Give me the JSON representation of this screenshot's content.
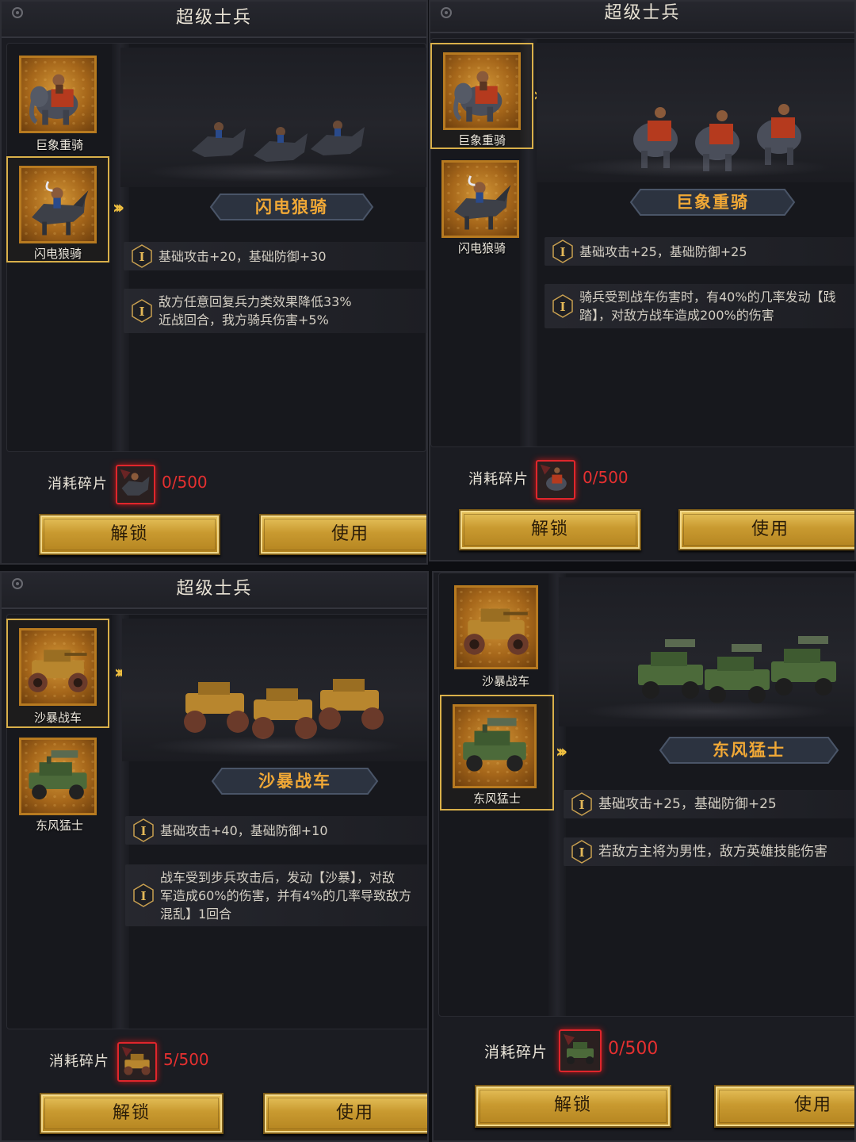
{
  "colors": {
    "accent_gold": "#d9b04a",
    "name_orange": "#f0a836",
    "cost_red": "#e53030",
    "button_gold": "#c99a30"
  },
  "panels": [
    {
      "title": "超级士兵",
      "cards": [
        {
          "label": "巨象重骑",
          "icon": "elephant-cavalry-icon"
        },
        {
          "label": "闪电狼骑",
          "icon": "wolf-cavalry-icon"
        }
      ],
      "selected_index": 1,
      "unit_name": "闪电狼骑",
      "abilities": [
        {
          "lines": [
            "基础攻击+20，基础防御+30"
          ]
        },
        {
          "lines": [
            "敌方任意回复兵力类效果降低33%",
            "近战回合，我方骑兵伤害+5%"
          ]
        }
      ],
      "cost_label": "消耗碎片",
      "cost_value": "0/500",
      "unlock_label": "解锁",
      "use_label": "使用"
    },
    {
      "title": "超级士兵",
      "cards": [
        {
          "label": "巨象重骑",
          "icon": "elephant-cavalry-icon"
        },
        {
          "label": "闪电狼骑",
          "icon": "wolf-cavalry-icon"
        }
      ],
      "selected_index": 0,
      "unit_name": "巨象重骑",
      "abilities": [
        {
          "lines": [
            "基础攻击+25，基础防御+25"
          ]
        },
        {
          "lines": [
            "骑兵受到战车伤害时，有40%的几率发动【践",
            "踏】，对敌方战车造成200%的伤害"
          ]
        }
      ],
      "cost_label": "消耗碎片",
      "cost_value": "0/500",
      "unlock_label": "解锁",
      "use_label": "使用"
    },
    {
      "title": "超级士兵",
      "cards": [
        {
          "label": "沙暴战车",
          "icon": "sandstorm-chariot-icon"
        },
        {
          "label": "东风猛士",
          "icon": "dongfeng-warrior-icon"
        }
      ],
      "selected_index": 0,
      "unit_name": "沙暴战车",
      "abilities": [
        {
          "lines": [
            "基础攻击+40，基础防御+10"
          ]
        },
        {
          "lines": [
            "战车受到步兵攻击后，发动【沙暴】，对敌",
            "军造成60%的伤害，并有4%的几率导致敌方",
            "混乱】1回合"
          ]
        }
      ],
      "cost_label": "消耗碎片",
      "cost_value": "5/500",
      "unlock_label": "解锁",
      "use_label": "使用"
    },
    {
      "title": "",
      "cards": [
        {
          "label": "沙暴战车",
          "icon": "sandstorm-chariot-icon"
        },
        {
          "label": "东风猛士",
          "icon": "dongfeng-warrior-icon"
        }
      ],
      "selected_index": 1,
      "unit_name": "东风猛士",
      "abilities": [
        {
          "lines": [
            "基础攻击+25，基础防御+25"
          ]
        },
        {
          "lines": [
            "若敌方主将为男性，敌方英雄技能伤害"
          ]
        }
      ],
      "cost_label": "消耗碎片",
      "cost_value": "0/500",
      "unlock_label": "解锁",
      "use_label": "使用"
    }
  ]
}
